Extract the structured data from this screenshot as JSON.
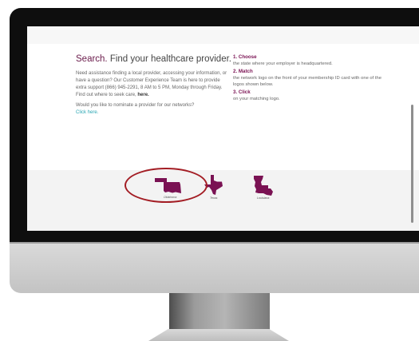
{
  "search": {
    "title_accent": "Search.",
    "title_rest": " Find your healthcare provider.",
    "paragraph": "Need assistance finding a local provider, accessing your information, or have a question? Our Customer Experience Team is here to provide extra support (866) 945-2291, 8 AM to 5 PM, Monday through Friday. Find out where to seek care, ",
    "here_link": "here.",
    "nominate_text": "Would you like to nominate a provider for our networks?",
    "nominate_link": "Click here."
  },
  "steps": [
    {
      "title": "1. Choose",
      "desc": "the state where your employer is headquartered."
    },
    {
      "title": "2. Match",
      "desc": "the network logo on the front of your membership ID card with one of the logos shown below."
    },
    {
      "title": "3. Click",
      "desc": "on your matching logo."
    }
  ],
  "states": [
    {
      "name": "Oklahoma",
      "icon": "oklahoma-state-icon"
    },
    {
      "name": "Texas",
      "icon": "texas-state-icon"
    },
    {
      "name": "Louisiana",
      "icon": "louisiana-state-icon"
    }
  ],
  "colors": {
    "accent": "#6a1b4b",
    "state_fill": "#7a1253",
    "link": "#2aa6b3",
    "highlight": "#a31d24"
  }
}
